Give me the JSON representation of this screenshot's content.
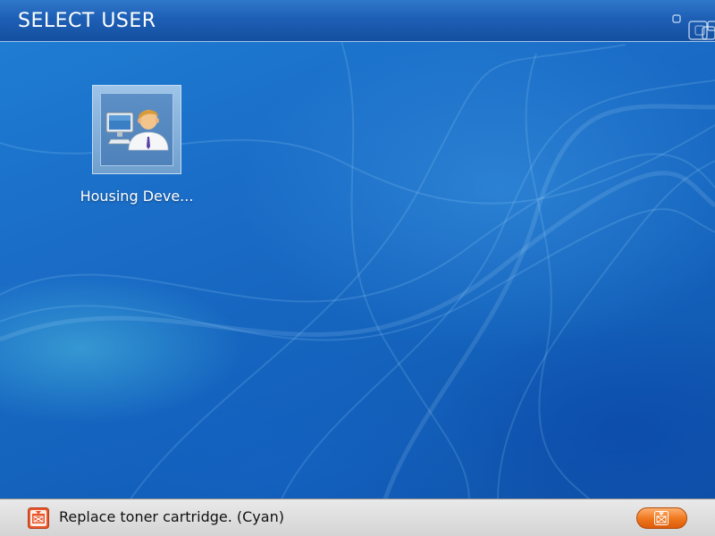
{
  "header": {
    "title": "SELECT USER"
  },
  "users": [
    {
      "label": "Housing Deve...",
      "icon": "user-at-computer-icon"
    }
  ],
  "status_bar": {
    "message": "Replace toner cartridge. (Cyan)",
    "status_icon": "toner-warning-icon",
    "button_icon": "toner-icon"
  },
  "colors": {
    "header": "#1d5fb5",
    "background": "#1a6cc6",
    "status_bar": "#d9d9d9",
    "status_button": "#f07a20"
  }
}
